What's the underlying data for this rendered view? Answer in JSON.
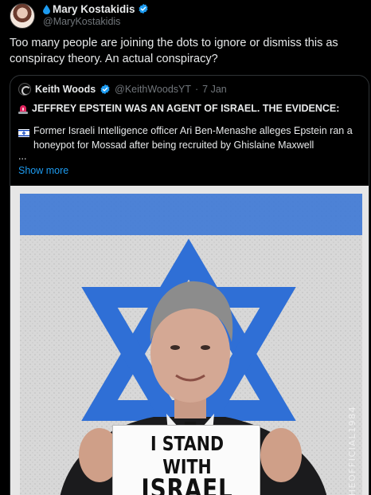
{
  "tweet": {
    "author": {
      "display_name": "Mary Kostakidis",
      "handle": "@MaryKostakidis",
      "name_prefix_icon": "water-drop-icon",
      "verified": true
    },
    "text": "Too many people are joining the dots to ignore or dismiss this as conspiracy theory. An actual conspiracy?"
  },
  "quoted_tweet": {
    "author": {
      "display_name": "Keith Woods",
      "handle": "@KeithWoodsYT",
      "separator": "·",
      "date": "7 Jan",
      "verified": true
    },
    "headline": "JEFFREY EPSTEIN WAS AN AGENT OF ISRAEL. THE EVIDENCE:",
    "headline_icon": "siren-icon",
    "body": "Former Israeli Intelligence officer Ari Ben-Menashe alleges Epstein ran a honeypot for Mossad after being recruited by Ghislaine Maxwell",
    "body_icon": "israel-flag-icon",
    "ellipsis": "...",
    "show_more_label": "Show more"
  },
  "media": {
    "description_icon": "photo-image",
    "sign_line_1": "I STAND WITH",
    "sign_line_2": "ISRAEL",
    "watermark": "@THEOFFICIAL1984",
    "colors": {
      "flag_blue": "#2f6fd6",
      "flag_white": "#e9e9e9",
      "suit": "#1b1b1d"
    }
  },
  "colors": {
    "background": "#000000",
    "text_primary": "#e7e9ea",
    "text_secondary": "#71767b",
    "link": "#1d9bf0",
    "verified": "#1d9bf0",
    "border": "#2f3336"
  }
}
